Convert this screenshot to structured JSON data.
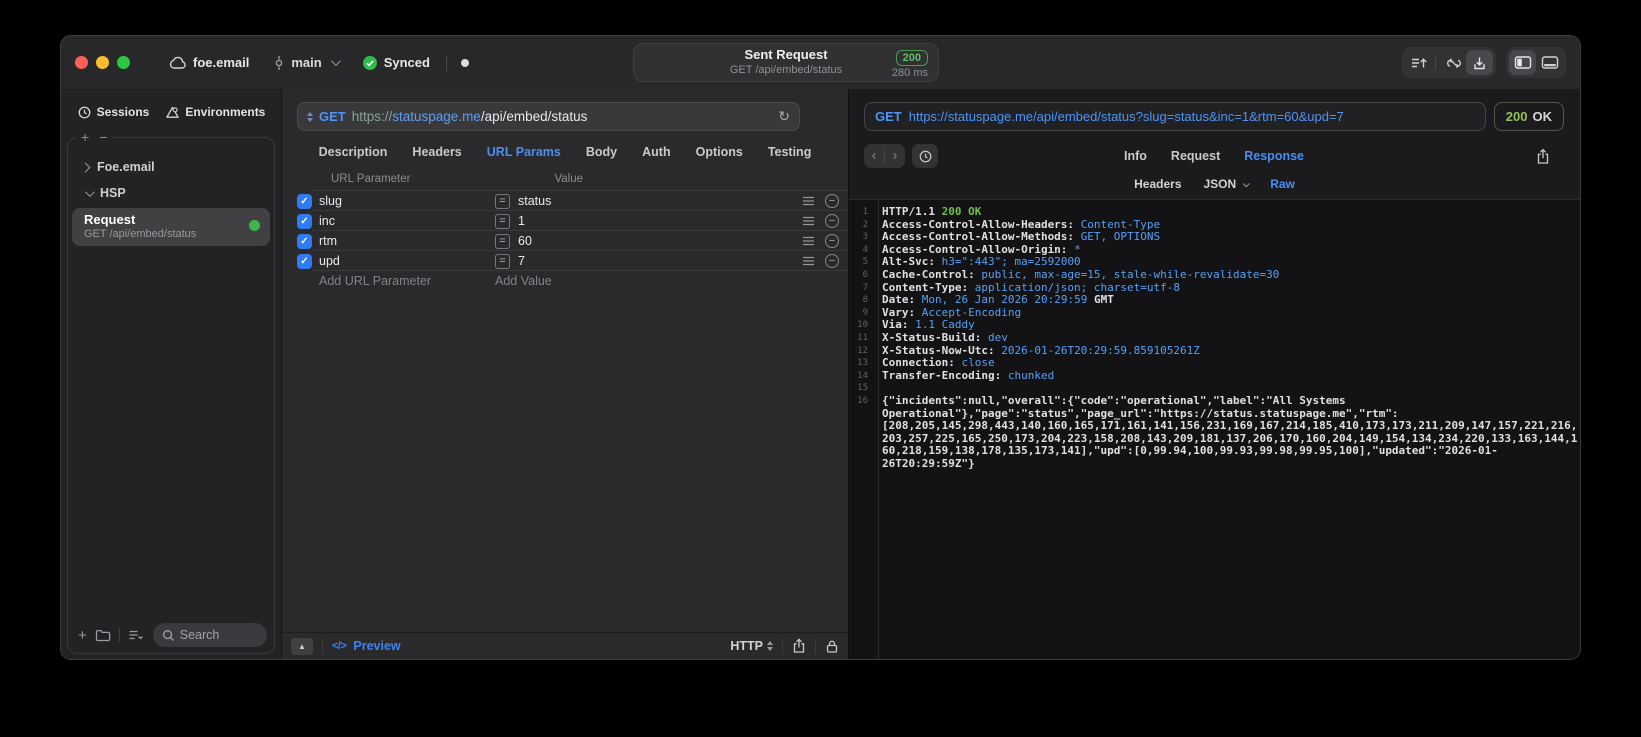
{
  "titlebar": {
    "project": "foe.email",
    "branch": "main",
    "sync_label": "Synced",
    "center": {
      "title": "Sent Request",
      "subtitle": "GET /api/embed/status",
      "status_code": "200",
      "duration": "280 ms"
    }
  },
  "sidebar": {
    "tabs": [
      {
        "label": "Sessions"
      },
      {
        "label": "Environments"
      }
    ],
    "tree": [
      {
        "label": "Foe.email",
        "expanded": false
      },
      {
        "label": "HSP",
        "expanded": true
      }
    ],
    "request_item": {
      "title": "Request",
      "subtitle": "GET /api/embed/status",
      "status_color": "#41b350"
    },
    "search_placeholder": "Search"
  },
  "request_pane": {
    "method": "GET",
    "url_scheme": "https://",
    "url_host": "statuspage.me",
    "url_path": "/api/embed/status",
    "tabs": [
      "Description",
      "Headers",
      "URL Params",
      "Body",
      "Auth",
      "Options",
      "Testing"
    ],
    "active_tab": "URL Params",
    "table": {
      "columns": [
        "URL Parameter",
        "Value"
      ],
      "rows": [
        {
          "name": "slug",
          "value": "status",
          "checked": true
        },
        {
          "name": "inc",
          "value": "1",
          "checked": true
        },
        {
          "name": "rtm",
          "value": "60",
          "checked": true
        },
        {
          "name": "upd",
          "value": "7",
          "checked": true
        }
      ],
      "add_row": {
        "name_placeholder": "Add URL Parameter",
        "value_placeholder": "Add Value"
      }
    },
    "footer": {
      "preview_label": "Preview",
      "code_glyph": "</>",
      "http_label": "HTTP"
    }
  },
  "response_pane": {
    "method": "GET",
    "url": "https://statuspage.me/api/embed/status?slug=status&inc=1&rtm=60&upd=7",
    "status": {
      "code": "200",
      "text": "OK"
    },
    "tabs": [
      "Info",
      "Request",
      "Response"
    ],
    "active_tab": "Response",
    "subtabs": [
      {
        "label": "Headers",
        "dropdown": false
      },
      {
        "label": "JSON",
        "dropdown": true
      },
      {
        "label": "Raw",
        "dropdown": false
      }
    ],
    "active_subtab": "Raw",
    "body_lines": [
      {
        "num": 1,
        "segments": [
          {
            "t": "HTTP/1.1 ",
            "c": "plain"
          },
          {
            "t": "200 OK",
            "c": "green"
          }
        ]
      },
      {
        "num": 2,
        "segments": [
          {
            "t": "Access-Control-Allow-Headers: ",
            "c": "plain"
          },
          {
            "t": "Content-Type",
            "c": "blue"
          }
        ]
      },
      {
        "num": 3,
        "segments": [
          {
            "t": "Access-Control-Allow-Methods: ",
            "c": "plain"
          },
          {
            "t": "GET, OPTIONS",
            "c": "blue"
          }
        ]
      },
      {
        "num": 4,
        "segments": [
          {
            "t": "Access-Control-Allow-Origin: ",
            "c": "plain"
          },
          {
            "t": "*",
            "c": "blue"
          }
        ]
      },
      {
        "num": 5,
        "segments": [
          {
            "t": "Alt-Svc: ",
            "c": "plain"
          },
          {
            "t": "h3=\":443\"; ma=2592000",
            "c": "blue"
          }
        ]
      },
      {
        "num": 6,
        "segments": [
          {
            "t": "Cache-Control: ",
            "c": "plain"
          },
          {
            "t": "public, max-age=15, stale-while-revalidate=30",
            "c": "blue"
          }
        ]
      },
      {
        "num": 7,
        "segments": [
          {
            "t": "Content-Type: ",
            "c": "plain"
          },
          {
            "t": "application/json; charset=utf-8",
            "c": "blue"
          }
        ]
      },
      {
        "num": 8,
        "segments": [
          {
            "t": "Date: ",
            "c": "plain"
          },
          {
            "t": "Mon, 26 Jan 2026 20:29:59",
            "c": "blue"
          },
          {
            "t": " GMT",
            "c": "plain"
          }
        ]
      },
      {
        "num": 9,
        "segments": [
          {
            "t": "Vary: ",
            "c": "plain"
          },
          {
            "t": "Accept-Encoding",
            "c": "blue"
          }
        ]
      },
      {
        "num": 10,
        "segments": [
          {
            "t": "Via: ",
            "c": "plain"
          },
          {
            "t": "1.1 Caddy",
            "c": "blue"
          }
        ]
      },
      {
        "num": 11,
        "segments": [
          {
            "t": "X-Status-Build: ",
            "c": "plain"
          },
          {
            "t": "dev",
            "c": "blue"
          }
        ]
      },
      {
        "num": 12,
        "segments": [
          {
            "t": "X-Status-Now-Utc: ",
            "c": "plain"
          },
          {
            "t": "2026-01-26T20:29:59.859105261Z",
            "c": "blue"
          }
        ]
      },
      {
        "num": 13,
        "segments": [
          {
            "t": "Connection: ",
            "c": "plain"
          },
          {
            "t": "close",
            "c": "blue"
          }
        ]
      },
      {
        "num": 14,
        "segments": [
          {
            "t": "Transfer-Encoding: ",
            "c": "plain"
          },
          {
            "t": "chunked",
            "c": "blue"
          }
        ]
      },
      {
        "num": 15,
        "segments": []
      },
      {
        "num": 16,
        "segments": [
          {
            "t": "{\"incidents\":null,\"overall\":{\"code\":\"operational\",\"label\":\"All Systems Operational\"},\"page\":\"status\",\"page_url\":\"https://status.statuspage.me\",\"rtm\":[208,205,145,298,443,140,160,165,171,161,141,156,231,169,167,214,185,410,173,173,211,209,147,157,221,216,203,257,225,165,250,173,204,223,158,208,143,209,181,137,206,170,160,204,149,154,134,234,220,133,163,144,160,218,159,138,178,135,173,141],\"upd\":[0,99.94,100,99.93,99.98,99.95,100],\"updated\":\"2026-01-26T20:29:59Z\"}",
            "c": "plain"
          }
        ]
      }
    ]
  },
  "glyphs": {
    "check": "✓",
    "plus": "+",
    "minus": "−",
    "collapse": "▲",
    "back": "‹",
    "forward": "›",
    "equals": "=",
    "refresh": "↻"
  },
  "colors": {
    "accent_blue": "#4b8df5",
    "code_blue": "#55a0f6",
    "code_green": "#6fbe4c",
    "badge_green": "#5fc35f",
    "checkbox_blue": "#2e7bf6",
    "status_dot_green": "#41b350",
    "traffic_red": "#ff5f57",
    "traffic_yellow": "#febc2e",
    "traffic_green": "#28c840"
  }
}
